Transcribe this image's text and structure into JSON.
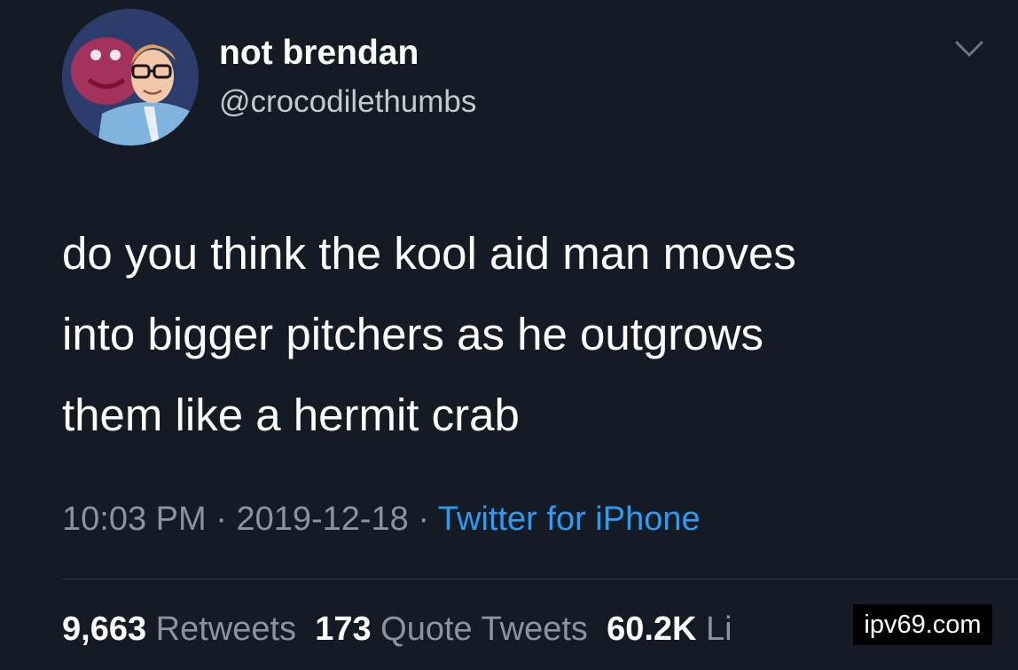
{
  "user": {
    "display_name": "not brendan",
    "handle": "@crocodilethumbs"
  },
  "tweet": {
    "text_lines": [
      "do you think the kool aid man moves",
      "into bigger pitchers as he outgrows",
      "them like a hermit crab"
    ]
  },
  "meta": {
    "time": "10:03 PM",
    "separator": " · ",
    "date": "2019-12-18",
    "source": "Twitter for iPhone"
  },
  "stats": {
    "retweets_count": "9,663",
    "retweets_label": "Retweets",
    "quotes_count": "173",
    "quotes_label": "Quote Tweets",
    "likes_count": "60.2K",
    "likes_label": "Li"
  },
  "watermark": {
    "text": "ipv69.com"
  },
  "icons": {
    "menu": "chevron-down-icon"
  },
  "colors": {
    "background": "#151b24",
    "text": "#ffffff",
    "muted": "#8a949f",
    "link": "#2b9cf2"
  }
}
